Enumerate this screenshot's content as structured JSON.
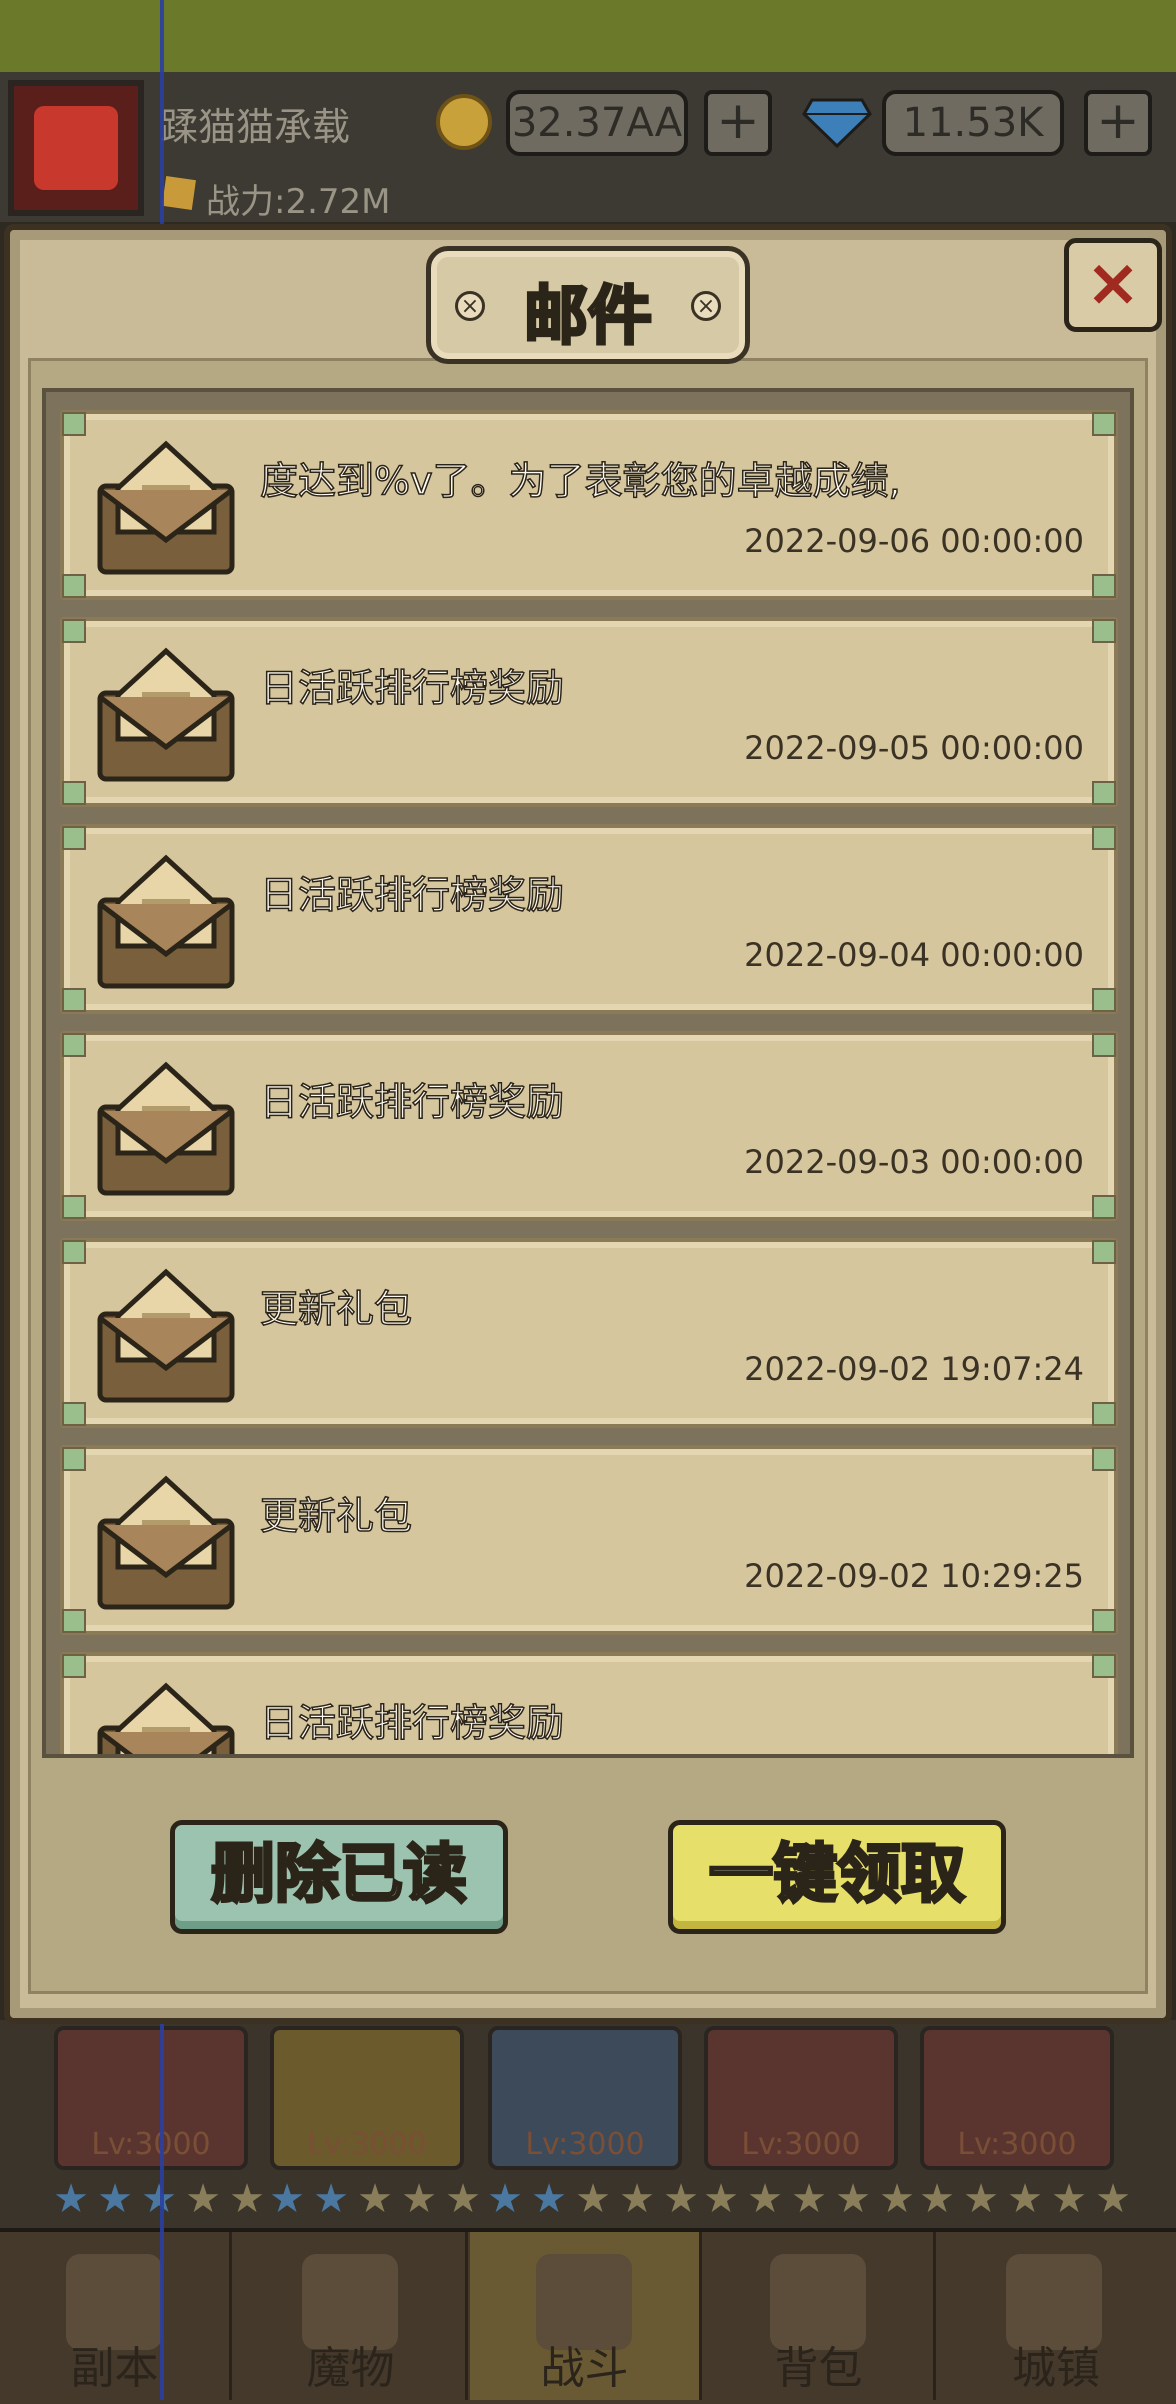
{
  "header": {
    "player_name": "蹂猫猫承载",
    "power": "战力:2.72M",
    "gold": "32.37AA",
    "gems": "11.53K",
    "plus": "+"
  },
  "modal": {
    "title": "邮件",
    "close": "×",
    "mails": [
      {
        "title": "度达到%v了。为了表彰您的卓越成绩,",
        "time": "2022-09-06 00:00:00"
      },
      {
        "title": "日活跃排行榜奖励",
        "time": "2022-09-05 00:00:00"
      },
      {
        "title": "日活跃排行榜奖励",
        "time": "2022-09-04 00:00:00"
      },
      {
        "title": "日活跃排行榜奖励",
        "time": "2022-09-03 00:00:00"
      },
      {
        "title": "更新礼包",
        "time": "2022-09-02 19:07:24"
      },
      {
        "title": "更新礼包",
        "time": "2022-09-02 10:29:25"
      },
      {
        "title": "日活跃排行榜奖励",
        "time": ""
      }
    ],
    "delete_read": "删除已读",
    "claim_all": "一键领取"
  },
  "heroes": [
    {
      "level": "Lv:3000"
    },
    {
      "level": "Lv:3000"
    },
    {
      "level": "Lv:3000"
    },
    {
      "level": "Lv:3000"
    },
    {
      "level": "Lv:3000"
    }
  ],
  "nav": {
    "items": [
      {
        "label": "副本",
        "icon": "map-icon"
      },
      {
        "label": "魔物",
        "icon": "monster-icon"
      },
      {
        "label": "战斗",
        "icon": "swords-icon"
      },
      {
        "label": "背包",
        "icon": "backpack-icon"
      },
      {
        "label": "城镇",
        "icon": "town-icon"
      }
    ],
    "active_index": 2
  },
  "colors": {
    "modal_bg": "#c9bb97",
    "title_gold": "#f1d36c",
    "close_red": "#a02a20",
    "delete_btn": "#9cc3b0",
    "claim_btn": "#e6e06a"
  }
}
